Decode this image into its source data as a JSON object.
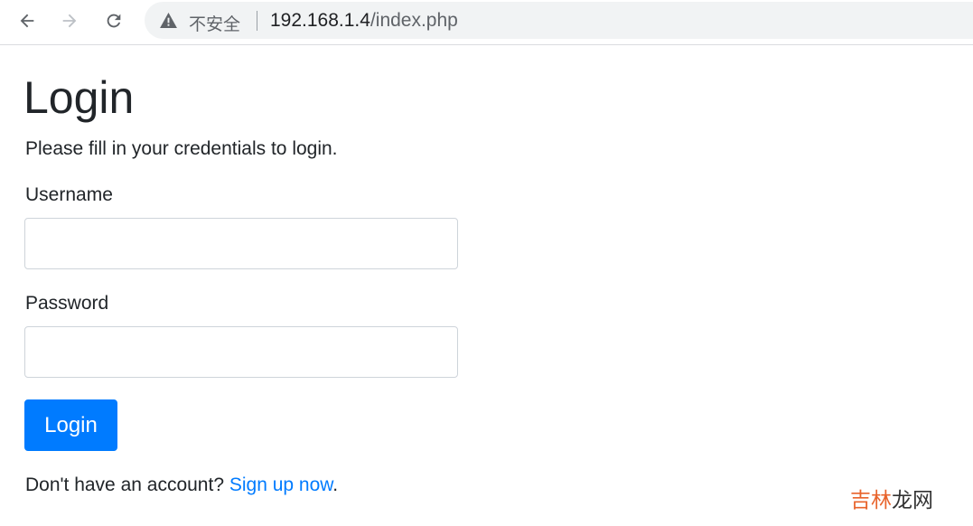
{
  "browser": {
    "back_icon": "arrow-left-icon",
    "forward_icon": "arrow-right-icon",
    "reload_icon": "reload-icon",
    "security_icon": "warning-triangle-icon",
    "security_label": "不安全",
    "url_host": "192.168.1.4",
    "url_path": "/index.php"
  },
  "page": {
    "title": "Login",
    "subtitle": "Please fill in your credentials to login."
  },
  "form": {
    "username_label": "Username",
    "username_value": "",
    "password_label": "Password",
    "password_value": "",
    "submit_label": "Login"
  },
  "footer": {
    "signup_prompt": "Don't have an account? ",
    "signup_link": "Sign up now",
    "signup_suffix": "."
  },
  "watermark": {
    "part1": "吉林",
    "part2": "龙网"
  },
  "colors": {
    "primary": "#007bff",
    "text": "#212529",
    "input_border": "#ced4da",
    "omnibox_bg": "#f1f3f4",
    "watermark_accent": "#e8632b"
  }
}
